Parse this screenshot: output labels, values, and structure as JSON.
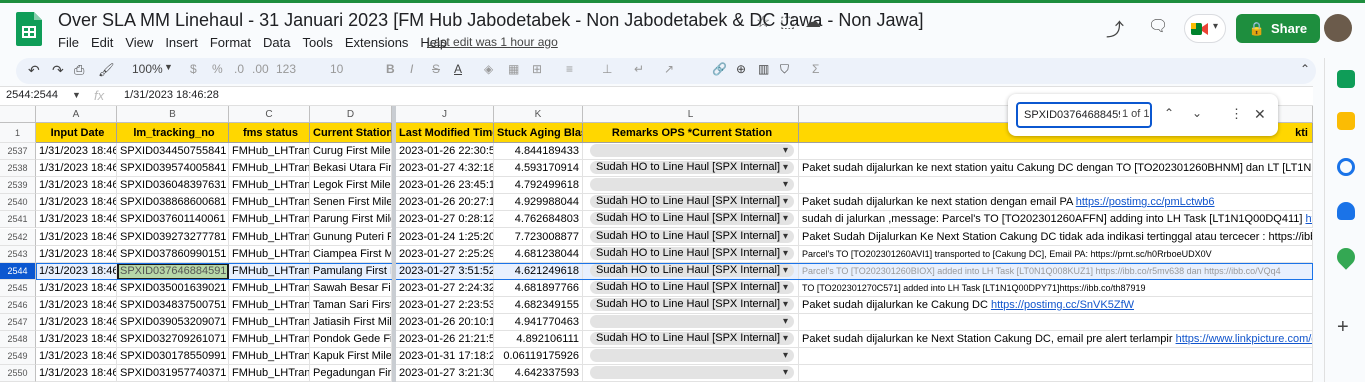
{
  "title": "Over SLA MM Linehaul - 31 Januari 2023 [FM Hub Jabodetabek - Non Jabodetabek & DC Jawa - Non Jawa]",
  "menu": [
    "File",
    "Edit",
    "View",
    "Insert",
    "Format",
    "Data",
    "Tools",
    "Extensions",
    "Help"
  ],
  "last_edit": "Last edit was 1 hour ago",
  "share_label": "Share",
  "toolbar": {
    "zoom": "100%",
    "currency": "$",
    "percent": "%",
    "dec_dec": ".0",
    "inc_dec": ".00",
    "format_123": "123",
    "font_size": "10",
    "bold": "B",
    "italic": "I",
    "strike": "S",
    "text_color": "A"
  },
  "namebox": "2544:2544",
  "fx_label": "fx",
  "formula": "1/31/2023 18:46:28",
  "find": {
    "query": "SPXID037646884591",
    "count": "1 of 1"
  },
  "columns": [
    "A",
    "B",
    "C",
    "D",
    "J",
    "K",
    "L"
  ],
  "headers": [
    "Input Date",
    "lm_tracking_no",
    "fms status",
    "Current Station",
    "Last Modified Time",
    "Stuck Aging Blast",
    "Remarks OPS *Current Station",
    "kti"
  ],
  "rows": [
    {
      "n": "2537",
      "a": "1/31/2023 18:46",
      "b": "SPXID034450755841",
      "c": "FMHub_LHTrans",
      "d": "Curug First Mile",
      "j": "2023-01-26 22:30:50",
      "k": "4.844189433",
      "l": "",
      "m": ""
    },
    {
      "n": "2538",
      "a": "1/31/2023 18:46",
      "b": "SPXID039574005841",
      "c": "FMHub_LHTrans",
      "d": "Bekasi Utara Fir",
      "j": "2023-01-27 4:32:18",
      "k": "4.593170914",
      "l": "Sudah HO to Line Haul [SPX Internal]",
      "m": "Paket sudah dijalurkan ke next station yaitu Cakung DC dengan TO [TO202301260BHNM] dan LT [LT1N1Q"
    },
    {
      "n": "2539",
      "a": "1/31/2023 18:46",
      "b": "SPXID036048397631",
      "c": "FMHub_LHTrans",
      "d": "Legok First Mile",
      "j": "2023-01-26 23:45:16",
      "k": "4.792499618",
      "l": "",
      "m": ""
    },
    {
      "n": "2540",
      "a": "1/31/2023 18:46",
      "b": "SPXID038868600681",
      "c": "FMHub_LHTrans",
      "d": "Senen First Mile",
      "j": "2023-01-26 20:27:17",
      "k": "4.929988044",
      "l": "Sudah HO to Line Haul [SPX Internal]",
      "m": "Paket sudah dijalurkan ke next station dengan email PA ",
      "ml": "https://postimg.cc/pmLctwb6"
    },
    {
      "n": "2541",
      "a": "1/31/2023 18:46",
      "b": "SPXID037601140061",
      "c": "FMHub_LHTrans",
      "d": "Parung First Mile",
      "j": "2023-01-27 0:28:12",
      "k": "4.762684803",
      "l": "Sudah HO to Line Haul [SPX Internal]",
      "m": "sudah di jalurkan ,message: Parcel's TO [TO202301260AFFN] adding into LH Task [LT1N1Q00DQ411] ",
      "ml": "https"
    },
    {
      "n": "2542",
      "a": "1/31/2023 18:46",
      "b": "SPXID039273277781",
      "c": "FMHub_LHTrans",
      "d": "Gunung Puteri F",
      "j": "2023-01-24 1:25:20",
      "k": "7.723008877",
      "l": "Sudah HO to Line Haul [SPX Internal]",
      "m": "Paket Sudah Dijalurkan Ke Next Station Cakung DC tidak ada indikasi tertinggal atau tercecer : https://ibb.co"
    },
    {
      "n": "2543",
      "a": "1/31/2023 18:46",
      "b": "SPXID037860990151",
      "c": "FMHub_LHTrans",
      "d": "Ciampea First M",
      "j": "2023-01-27 2:25:29",
      "k": "4.681238044",
      "l": "Sudah HO to Line Haul [SPX Internal]",
      "m": "Parcel's TO [TO202301260AVI1] transported to [Cakung DC], Email PA: https://prnt.sc/h0RrboeUDX0V",
      "small": true
    },
    {
      "n": "2544",
      "a": "1/31/2023 18:46",
      "b": "SPXID037646884591",
      "c": "FMHub_LHTrans",
      "d": "Pamulang First M",
      "j": "2023-01-27 3:51:52",
      "k": "4.621249618",
      "l": "Sudah HO to Line Haul [SPX Internal]",
      "m": "Parcel's TO [TO202301260BIOX] added into LH Task [LT0N1Q008KUZ1] https://ibb.co/r5mv638 dan https://ibb.co/VQq4",
      "small": true,
      "sel": true
    },
    {
      "n": "2545",
      "a": "1/31/2023 18:46",
      "b": "SPXID035001639021",
      "c": "FMHub_LHTrans",
      "d": "Sawah Besar Fir",
      "j": "2023-01-27 2:24:32",
      "k": "4.681897766",
      "l": "Sudah HO to Line Haul [SPX Internal]",
      "m": "TO [TO202301270C571] added into LH Task [LT1N1Q00DPY71]https://ibb.co/th87919",
      "small": true
    },
    {
      "n": "2546",
      "a": "1/31/2023 18:46",
      "b": "SPXID034837500751",
      "c": "FMHub_LHTrans",
      "d": "Taman Sari First",
      "j": "2023-01-27 2:23:53",
      "k": "4.682349155",
      "l": "Sudah HO to Line Haul [SPX Internal]",
      "m": "Paket sudah dijalurkan ke Cakung DC ",
      "ml": "https://postimg.cc/SnVK5ZfW"
    },
    {
      "n": "2547",
      "a": "1/31/2023 18:46",
      "b": "SPXID039053209071",
      "c": "FMHub_LHTrans",
      "d": "Jatiasih First Mil",
      "j": "2023-01-26 20:10:19",
      "k": "4.941770463",
      "l": "",
      "m": ""
    },
    {
      "n": "2548",
      "a": "1/31/2023 18:46",
      "b": "SPXID032709261071",
      "c": "FMHub_LHTrans",
      "d": "Pondok Gede Fi",
      "j": "2023-01-26 21:21:50",
      "k": "4.892106111",
      "l": "Sudah HO to Line Haul [SPX Internal]",
      "m": "Paket sudah dijalurkan ke Next Station Cakung DC, email pre alert terlampir ",
      "ml": "https://www.linkpicture.com/q/L"
    },
    {
      "n": "2549",
      "a": "1/31/2023 18:46",
      "b": "SPXID030178550991",
      "c": "FMHub_LHTrans",
      "d": "Kapuk First Mile",
      "j": "2023-01-31 17:18:21",
      "k": "0.06119175926",
      "l": "",
      "m": ""
    },
    {
      "n": "2550",
      "a": "1/31/2023 18:46",
      "b": "SPXID031957740371",
      "c": "FMHub_LHTrans",
      "d": "Pegadungan Firs",
      "j": "2023-01-27 3:21:30",
      "k": "4.642337593",
      "l": "",
      "m": ""
    }
  ]
}
